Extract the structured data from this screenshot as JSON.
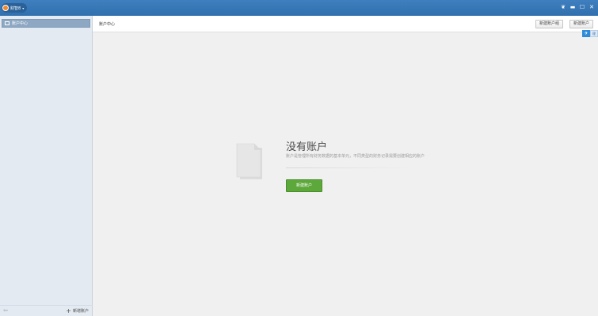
{
  "titlebar": {
    "app_name": "财智8",
    "app_caret": "▾",
    "controls": [
      "❦",
      "▬",
      "☐",
      "✕"
    ]
  },
  "sidebar": {
    "items": [
      {
        "label": "账户中心",
        "icon": "accounts-icon",
        "selected": true
      }
    ],
    "footer": {
      "back_icon": "⇦",
      "add_icon": "+",
      "add_label": "新增账户"
    }
  },
  "header": {
    "title": "账户中心",
    "new_group_label": "新建账户组",
    "new_account_label": "新建账户",
    "widget_icon": "✈",
    "widget_tab": "理"
  },
  "empty_state": {
    "title": "没有账户",
    "description": "账户是管理所有财务数据的基本单元，不同类型的财务记录需要创建相应的账户",
    "button_label": "新建账户"
  },
  "colors": {
    "titlebar": "#3674b3",
    "sidebar_bg": "#e4eaf2",
    "selected_item": "#8ea8c3",
    "primary_button": "#5da83a",
    "content_bg": "#f0f0f0"
  }
}
